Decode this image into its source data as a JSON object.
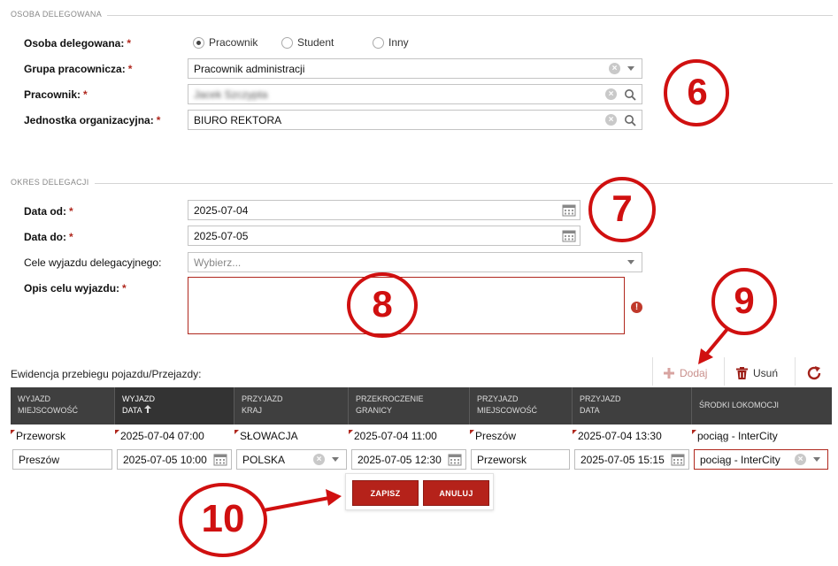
{
  "sections": {
    "delegate": "OSOBA DELEGOWANA",
    "period": "OKRES DELEGACJI"
  },
  "delegate": {
    "person_label": "Osoba delegowana:",
    "radio_options": [
      {
        "label": "Pracownik",
        "selected": true
      },
      {
        "label": "Student",
        "selected": false
      },
      {
        "label": "Inny",
        "selected": false
      }
    ],
    "group_label": "Grupa pracownicza:",
    "group_value": "Pracownik administracji",
    "employee_label": "Pracownik:",
    "employee_value": "Jacek Szczypta",
    "unit_label": "Jednostka organizacyjna:",
    "unit_value": "BIURO REKTORA"
  },
  "period": {
    "date_from_label": "Data od:",
    "date_from": "2025-07-04",
    "date_to_label": "Data do:",
    "date_to": "2025-07-05",
    "purposes_label": "Cele wyjazdu delegacyjnego:",
    "purposes_placeholder": "Wybierz...",
    "description_label": "Opis celu wyjazdu:"
  },
  "required_mark": "*",
  "journey": {
    "title": "Ewidencja przebiegu pojazdu/Przejazdy:",
    "add_label": "Dodaj",
    "remove_label": "Usuń",
    "columns": [
      {
        "line1": "WYJAZD",
        "line2": "MIEJSCOWOŚĆ"
      },
      {
        "line1": "WYJAZD",
        "line2": "DATA",
        "sort": "asc"
      },
      {
        "line1": "PRZYJAZD",
        "line2": "KRAJ"
      },
      {
        "line1": "PRZEKROCZENIE",
        "line2": "GRANICY"
      },
      {
        "line1": "PRZYJAZD",
        "line2": "MIEJSCOWOŚĆ"
      },
      {
        "line1": "PRZYJAZD",
        "line2": "DATA"
      },
      {
        "line1": "ŚRODKI LOKOMOCJI",
        "line2": ""
      }
    ],
    "rows": [
      [
        "Przeworsk",
        "2025-07-04 07:00",
        "SŁOWACJA",
        "2025-07-04 11:00",
        "Preszów",
        "2025-07-04 13:30",
        "pociąg - InterCity"
      ]
    ],
    "edit_row": [
      "Preszów",
      "2025-07-05 10:00",
      "POLSKA",
      "2025-07-05 12:30",
      "Przeworsk",
      "2025-07-05 15:15",
      "pociąg - InterCity"
    ],
    "save_label": "ZAPISZ",
    "cancel_label": "ANULUJ"
  },
  "annotations": [
    "6",
    "7",
    "8",
    "9",
    "10"
  ],
  "colors": {
    "accent": "#b5221a",
    "header_bg": "#3f3f3f",
    "annotation": "#d01010"
  },
  "icons": {
    "clear": "circle-x-icon",
    "dropdown": "chevron-down-icon",
    "search": "search-icon",
    "calendar": "calendar-icon",
    "error": "exclamation-icon",
    "add": "plus-icon",
    "remove": "trash-icon",
    "refresh": "refresh-icon",
    "sort": "arrow-up-icon"
  }
}
